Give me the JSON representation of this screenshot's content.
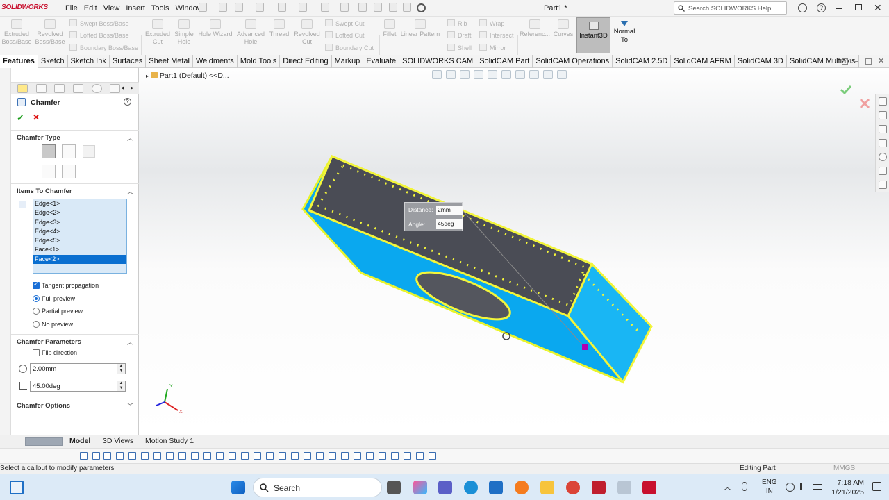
{
  "app": {
    "logo": "SOLIDWORKS",
    "document_title": "Part1 *"
  },
  "menu": [
    "File",
    "Edit",
    "View",
    "Insert",
    "Tools",
    "Window"
  ],
  "search": {
    "placeholder": "Search SOLIDWORKS Help"
  },
  "commands": {
    "extruded_boss": "Extruded Boss/Base",
    "revolved_boss": "Revolved Boss/Base",
    "swept_boss": "Swept Boss/Base",
    "lofted_boss": "Lofted Boss/Base",
    "boundary_boss": "Boundary Boss/Base",
    "extruded_cut": "Extruded Cut",
    "simple_hole": "Simple Hole",
    "hole_wizard": "Hole Wizard",
    "advanced_hole": "Advanced Hole",
    "thread": "Thread",
    "revolved_cut": "Revolved Cut",
    "swept_cut": "Swept Cut",
    "lofted_cut": "Lofted Cut",
    "boundary_cut": "Boundary Cut",
    "fillet": "Fillet",
    "linear_pattern": "Linear Pattern",
    "rib": "Rib",
    "draft": "Draft",
    "shell": "Shell",
    "wrap": "Wrap",
    "intersect": "Intersect",
    "mirror": "Mirror",
    "reference": "Referenc...",
    "curves": "Curves",
    "instant3d": "Instant3D",
    "normal_to": "Normal To"
  },
  "tabs": [
    "Features",
    "Sketch",
    "Sketch Ink",
    "Surfaces",
    "Sheet Metal",
    "Weldments",
    "Mold Tools",
    "Direct Editing",
    "Markup",
    "Evaluate",
    "SOLIDWORKS CAM",
    "SolidCAM Part",
    "SolidCAM Operations",
    "SolidCAM 2.5D",
    "SolidCAM AFRM",
    "SolidCAM 3D",
    "SolidCAM Multiaxis"
  ],
  "property_manager": {
    "title": "Chamfer",
    "sections": {
      "chamfer_type": "Chamfer Type",
      "items": "Items To Chamfer",
      "parameters": "Chamfer Parameters",
      "options": "Chamfer Options"
    },
    "items": [
      "Edge<1>",
      "Edge<2>",
      "Edge<3>",
      "Edge<4>",
      "Edge<5>",
      "Face<1>",
      "Face<2>"
    ],
    "selected_item": "Face<2>",
    "tangent_propagation": {
      "label": "Tangent propagation",
      "checked": true
    },
    "preview": {
      "full": "Full preview",
      "partial": "Partial preview",
      "none": "No preview",
      "selected": "full"
    },
    "flip_direction": {
      "label": "Flip direction",
      "checked": false
    },
    "distance": "2.00mm",
    "angle": "45.00deg"
  },
  "viewport": {
    "tree_label": "Part1 (Default) <<D...",
    "callout": {
      "distance_label": "Distance:",
      "distance_value": "2mm",
      "angle_label": "Angle:",
      "angle_value": "45deg"
    },
    "triad": {
      "x": "X",
      "y": "Y"
    }
  },
  "bottom_tabs": [
    "Model",
    "3D Views",
    "Motion Study 1"
  ],
  "status": {
    "left": "Select a callout to modify parameters",
    "mode": "Editing Part",
    "units": "MMGS"
  },
  "taskbar": {
    "search": "Search",
    "lang_top": "ENG",
    "lang_bottom": "IN",
    "time": "7:18 AM",
    "date": "1/21/2025"
  },
  "colors": {
    "part_blue": "#0aa6ee",
    "part_top": "#4a4c55",
    "edge_highlight": "#f3f53a",
    "selection": "#0a6fd0"
  }
}
